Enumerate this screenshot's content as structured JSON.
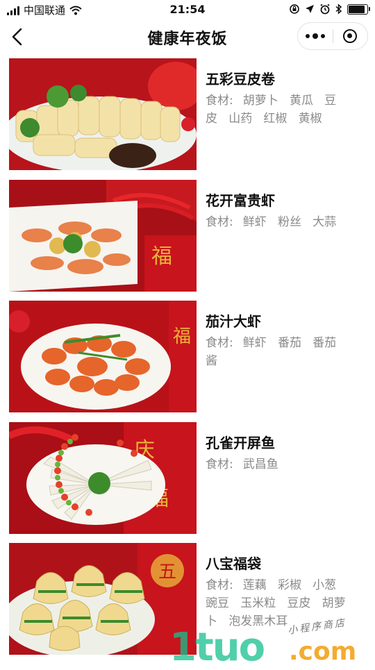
{
  "status_bar": {
    "carrier": "中国联通",
    "time": "21:54",
    "battery_level": 0.9
  },
  "nav": {
    "title": "健康年夜饭"
  },
  "ingredient_label": "食材:",
  "dishes": [
    {
      "name": "五彩豆皮卷",
      "ingredients": [
        "胡萝卜",
        "黄瓜",
        "豆皮",
        "山药",
        "红椒",
        "黄椒"
      ]
    },
    {
      "name": "花开富贵虾",
      "ingredients": [
        "鲜虾",
        "粉丝",
        "大蒜"
      ]
    },
    {
      "name": "茄汁大虾",
      "ingredients": [
        "鲜虾",
        "番茄",
        "番茄酱"
      ]
    },
    {
      "name": "孔雀开屏鱼",
      "ingredients": [
        "武昌鱼"
      ]
    },
    {
      "name": "八宝福袋",
      "ingredients": [
        "莲藕",
        "彩椒",
        "小葱",
        "豌豆",
        "玉米粒",
        "豆皮",
        "胡萝卜",
        "泡发黑木耳"
      ]
    }
  ],
  "watermark": {
    "logo_text": "1tuo",
    "domain_text": ".com",
    "tagline": "小程序商店"
  },
  "colors": {
    "festive_red": "#c8141c",
    "gold": "#e8b23a",
    "watermark_green": "#16c08f",
    "watermark_orange": "#f3a21b"
  }
}
